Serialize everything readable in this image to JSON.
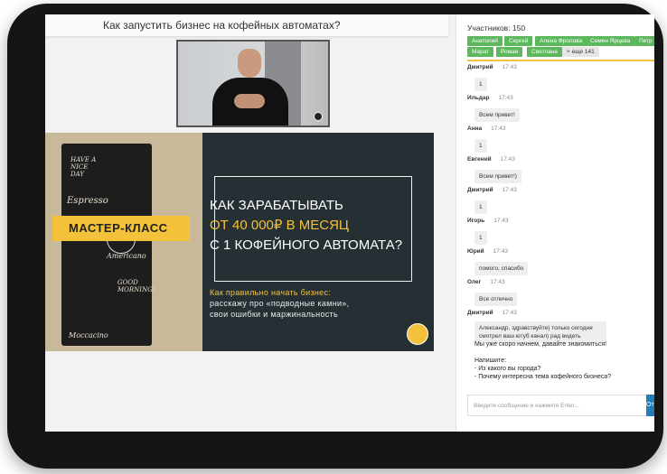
{
  "page": {
    "title": "Как запустить бизнес на кофейных автоматах?"
  },
  "slide": {
    "badge": "МАСТЕР-КЛАСС",
    "headline_line1": "КАК ЗАРАБАТЫВАТЬ",
    "headline_line2": "ОТ 40 000₽ В МЕСЯЦ",
    "headline_line3": "С 1 КОФЕЙНОГО АВТОМАТА?",
    "sub_line1": "Как правильно начать бизнес:",
    "sub_line2": "расскажу про «подводные камни»,",
    "sub_line3": "свои ошибки и маржинальность",
    "machine_words": [
      "HAVE A NICE DAY",
      "Espresso",
      "Americano",
      "GOOD MORNING!",
      "Moccacino"
    ]
  },
  "chat": {
    "participants": "Участников: 150",
    "tags": [
      "Анатолий",
      "Сергей",
      "Алена Фролова",
      "Семен Ярцева",
      "Петр",
      "Марат",
      "Роман",
      "Светлана",
      "+ еще 141"
    ],
    "messages": [
      {
        "author": "Дмитрий",
        "time": "17:43",
        "text": "1"
      },
      {
        "author": "Ильдар",
        "time": "17:43",
        "text": "Всем привет!"
      },
      {
        "author": "Анна",
        "time": "17:43",
        "text": "1"
      },
      {
        "author": "Евгений",
        "time": "17:43",
        "text": "Всем привет!)"
      },
      {
        "author": "Дмитрий",
        "time": "17:43",
        "text": "1"
      },
      {
        "author": "Игорь",
        "time": "17:43",
        "text": "1"
      },
      {
        "author": "Юрий",
        "time": "17:43",
        "text": "помого, спасибо"
      },
      {
        "author": "Олег",
        "time": "17:43",
        "text": "Все отлично"
      },
      {
        "author": "Дмитрий",
        "time": "17:43",
        "text": "Александр, здравствуйте) только сегодня смотрел ваш ютуб канал) рад видеть"
      }
    ],
    "system_line1": "Мы уже скоро начнем, давайте знакомиться!",
    "system_line2": "Напишите:",
    "system_line3": "- Из какого вы города?",
    "system_line4": "- Почему интересна тема кофейного бизнеса?",
    "input_placeholder": "Введите сообщение и нажмите Enter...",
    "send_label": "Отправить"
  },
  "colors": {
    "accent": "#f3c13a",
    "tag_green": "#5cb85c",
    "send_blue": "#1f7db8",
    "slide_dark": "#263034"
  }
}
